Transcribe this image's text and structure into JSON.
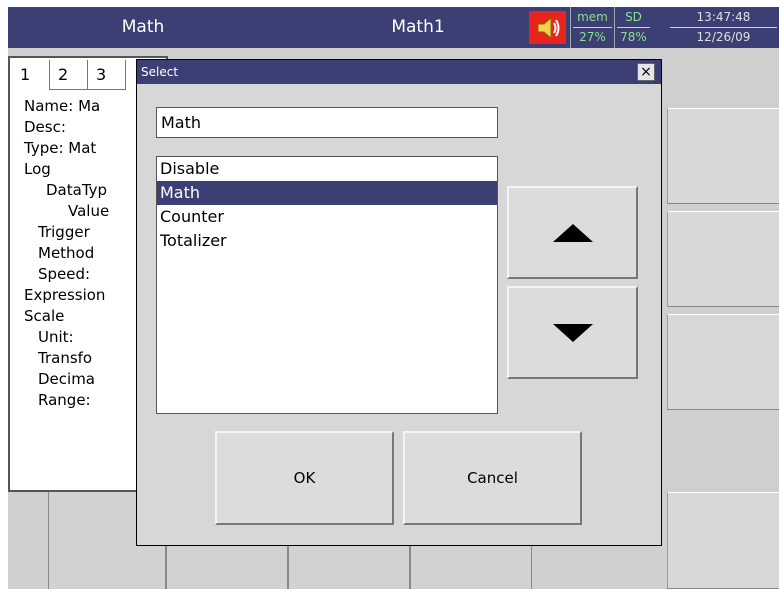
{
  "header": {
    "title_left": "Math",
    "title_right": "Math1",
    "mem_label": "mem",
    "mem_value": "27%",
    "sd_label": "SD",
    "sd_value": "78%",
    "time": "13:47:48",
    "date": "12/26/09",
    "speaker_icon": "speaker-icon",
    "accent_color": "#3b3f73",
    "speaker_color": "#e8241f"
  },
  "tabs": [
    "1",
    "2",
    "3"
  ],
  "tree": [
    "Name: Ma",
    "Desc:",
    "Type: Mat",
    "Log",
    "DataTyp",
    "Value",
    "Trigger",
    "Method",
    "Speed:",
    "Expression",
    "Scale",
    "Unit:",
    "Transfo",
    "Decima",
    "Range:"
  ],
  "dialog": {
    "title": "Select",
    "close_label": "×",
    "current_value": "Math",
    "options": [
      "Disable",
      "Math",
      "Counter",
      "Totalizer"
    ],
    "selected_index": 1,
    "up_icon": "up-arrow-icon",
    "down_icon": "down-arrow-icon",
    "ok_label": "OK",
    "cancel_label": "Cancel"
  }
}
